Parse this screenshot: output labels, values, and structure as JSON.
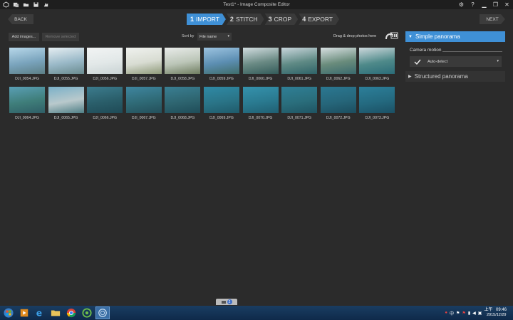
{
  "window": {
    "title": "Test1* - Image Composite Editor"
  },
  "nav": {
    "back_label": "BACK",
    "next_label": "NEXT",
    "steps": [
      {
        "num": "1",
        "label": "IMPORT",
        "active": true
      },
      {
        "num": "2",
        "label": "STITCH",
        "active": false
      },
      {
        "num": "3",
        "label": "CROP",
        "active": false
      },
      {
        "num": "4",
        "label": "EXPORT",
        "active": false
      }
    ]
  },
  "toolbar": {
    "add_label": "Add images...",
    "remove_label": "Remove selected",
    "sort_by_label": "Sort by",
    "sort_value": "File name",
    "drag_text": "Drag & drop photos here"
  },
  "thumbnails": [
    {
      "name": "DJI_0054.JPG",
      "colors": [
        "#b8d8ea",
        "#7aa4bd",
        "#5c7f86"
      ]
    },
    {
      "name": "DJI_0055.JPG",
      "colors": [
        "#e6eef2",
        "#9ab9c8",
        "#6a8b8f"
      ]
    },
    {
      "name": "DJI_0056.JPG",
      "colors": [
        "#f2f4f4",
        "#e2e8e8",
        "#c9d3d4"
      ]
    },
    {
      "name": "DJI_0057.JPG",
      "colors": [
        "#f0f2ef",
        "#d8dcd2",
        "#8f9a7a"
      ]
    },
    {
      "name": "DJI_0058.JPG",
      "colors": [
        "#e9ecea",
        "#bcc6b8",
        "#6f7d60"
      ]
    },
    {
      "name": "DJI_0059.JPG",
      "colors": [
        "#9cc3e0",
        "#5c8eb2",
        "#3f6d6a"
      ]
    },
    {
      "name": "DJI_0060.JPG",
      "colors": [
        "#d2dde0",
        "#6a8a84",
        "#345c5a"
      ]
    },
    {
      "name": "DJI_0061.JPG",
      "colors": [
        "#c9d6dc",
        "#5f8a85",
        "#2f6368"
      ]
    },
    {
      "name": "DJI_0062.JPG",
      "colors": [
        "#d8e0e2",
        "#6a8c7c",
        "#3a6a6e"
      ]
    },
    {
      "name": "DJI_0063.JPG",
      "colors": [
        "#cdd8dc",
        "#4f8a8a",
        "#2b6c78"
      ]
    },
    {
      "name": "DJI_0064.JPG",
      "colors": [
        "#5a9fb5",
        "#3f7e7a",
        "#2f5e66"
      ]
    },
    {
      "name": "DJI_0065.JPG",
      "colors": [
        "#7ab0c8",
        "#b9c9cc",
        "#4f7f86"
      ]
    },
    {
      "name": "DJI_0066.JPG",
      "colors": [
        "#3c7c8e",
        "#2a5e6a",
        "#1f4a56"
      ]
    },
    {
      "name": "DJI_0067.JPG",
      "colors": [
        "#3f86a0",
        "#2f6a76",
        "#244f5a"
      ]
    },
    {
      "name": "DJI_0068.JPG",
      "colors": [
        "#3a7f93",
        "#2e6570",
        "#1f4c58"
      ]
    },
    {
      "name": "DJI_0069.JPG",
      "colors": [
        "#2f8aa6",
        "#2a7487",
        "#1f5a6a"
      ]
    },
    {
      "name": "DJI_0070.JPG",
      "colors": [
        "#3592ad",
        "#2a7a90",
        "#205f72"
      ]
    },
    {
      "name": "DJI_0071.JPG",
      "colors": [
        "#2f7f96",
        "#2a6e7c",
        "#1f5462"
      ]
    },
    {
      "name": "DJI_0072.JPG",
      "colors": [
        "#2b7892",
        "#26667a",
        "#1c4d5e"
      ]
    },
    {
      "name": "DJI_0073.JPG",
      "colors": [
        "#2c7f9a",
        "#246a80",
        "#1b5064"
      ]
    }
  ],
  "panel": {
    "simple_panorama": "Simple panorama",
    "camera_motion_label": "Camera motion",
    "camera_motion_value": "Auto-detect",
    "structured_panorama": "Structured panorama"
  },
  "bottom": {
    "badge_count": "2"
  },
  "taskbar": {
    "time": "09:46",
    "date": "2015/12/29",
    "ampm": "上午",
    "ime": "中",
    "accent": "#1a3d62"
  },
  "colors": {
    "accent": "#3f90d6",
    "background": "#2b2b2b"
  }
}
